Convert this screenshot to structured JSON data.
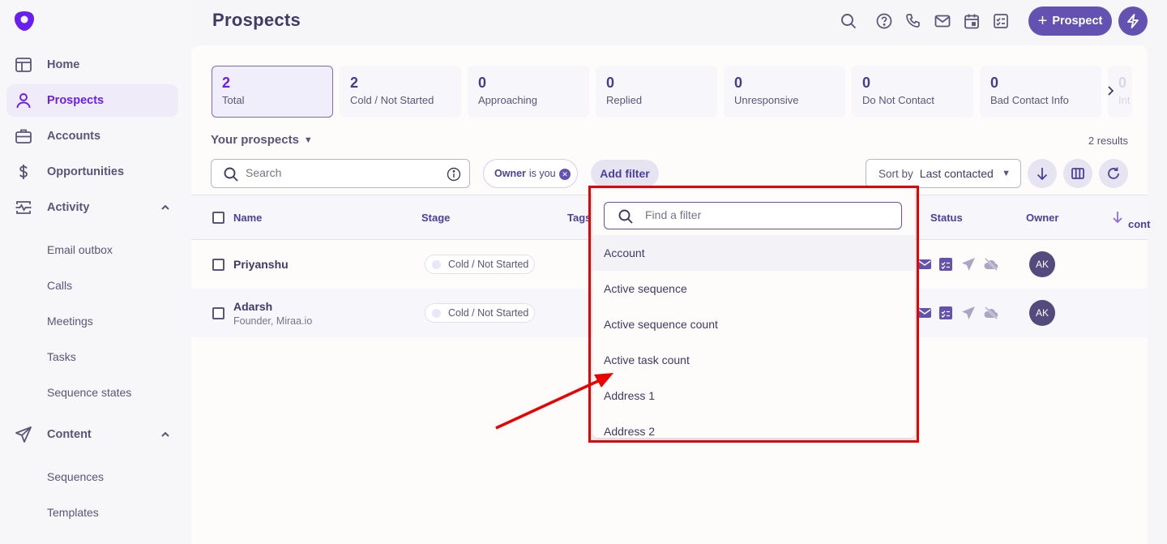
{
  "app": {
    "page_title": "Prospects",
    "brand_color": "#6a1ff0",
    "accent_color": "#6452b3"
  },
  "sidebar": {
    "logo": "outreach-logo-icon",
    "items": [
      {
        "label": "Home",
        "icon": "layout-icon",
        "active": false
      },
      {
        "label": "Prospects",
        "icon": "person-icon",
        "active": true
      },
      {
        "label": "Accounts",
        "icon": "briefcase-icon",
        "active": false
      },
      {
        "label": "Opportunities",
        "icon": "dollar-icon",
        "active": false
      },
      {
        "label": "Activity",
        "icon": "activity-icon",
        "active": false,
        "expanded": true,
        "children": [
          "Email outbox",
          "Calls",
          "Meetings",
          "Tasks",
          "Sequence states"
        ]
      },
      {
        "label": "Content",
        "icon": "send-icon",
        "active": false,
        "expanded": true,
        "children": [
          "Sequences",
          "Templates"
        ]
      }
    ]
  },
  "header": {
    "icons": [
      "search-icon",
      "help-icon",
      "phone-icon",
      "mail-icon",
      "calendar-icon",
      "tasks-icon"
    ],
    "add_button": {
      "plus": "+",
      "label": "Prospect"
    },
    "quick_action_icon": "bolt-icon"
  },
  "stats": [
    {
      "count": "2",
      "label": "Total",
      "active": true
    },
    {
      "count": "2",
      "label": "Cold / Not Started"
    },
    {
      "count": "0",
      "label": "Approaching"
    },
    {
      "count": "0",
      "label": "Replied"
    },
    {
      "count": "0",
      "label": "Unresponsive"
    },
    {
      "count": "0",
      "label": "Do Not Contact"
    },
    {
      "count": "0",
      "label": "Bad Contact Info"
    },
    {
      "count": "0",
      "label": "Int"
    }
  ],
  "list": {
    "title": "Your prospects",
    "results": "2 results",
    "search_placeholder": "Search",
    "filter_chip": {
      "field": "Owner",
      "rest": "is you"
    },
    "add_filter": "Add filter",
    "sort_label": "Sort by",
    "sort_value": "Last contacted"
  },
  "table": {
    "columns": [
      "Name",
      "Stage",
      "Tags",
      "Status",
      "Owner",
      "cont"
    ],
    "rows": [
      {
        "name": "Priyanshu",
        "subtitle": "",
        "stage": "Cold / Not Started",
        "owner": "AK"
      },
      {
        "name": "Adarsh",
        "subtitle": "Founder, Miraa.io",
        "stage": "Cold / Not Started",
        "owner": "AK"
      }
    ]
  },
  "filter_dropdown": {
    "search_placeholder": "Find a filter",
    "options": [
      "Account",
      "Active sequence",
      "Active sequence count",
      "Active task count",
      "Address 1",
      "Address 2"
    ],
    "highlighted": "Account"
  }
}
